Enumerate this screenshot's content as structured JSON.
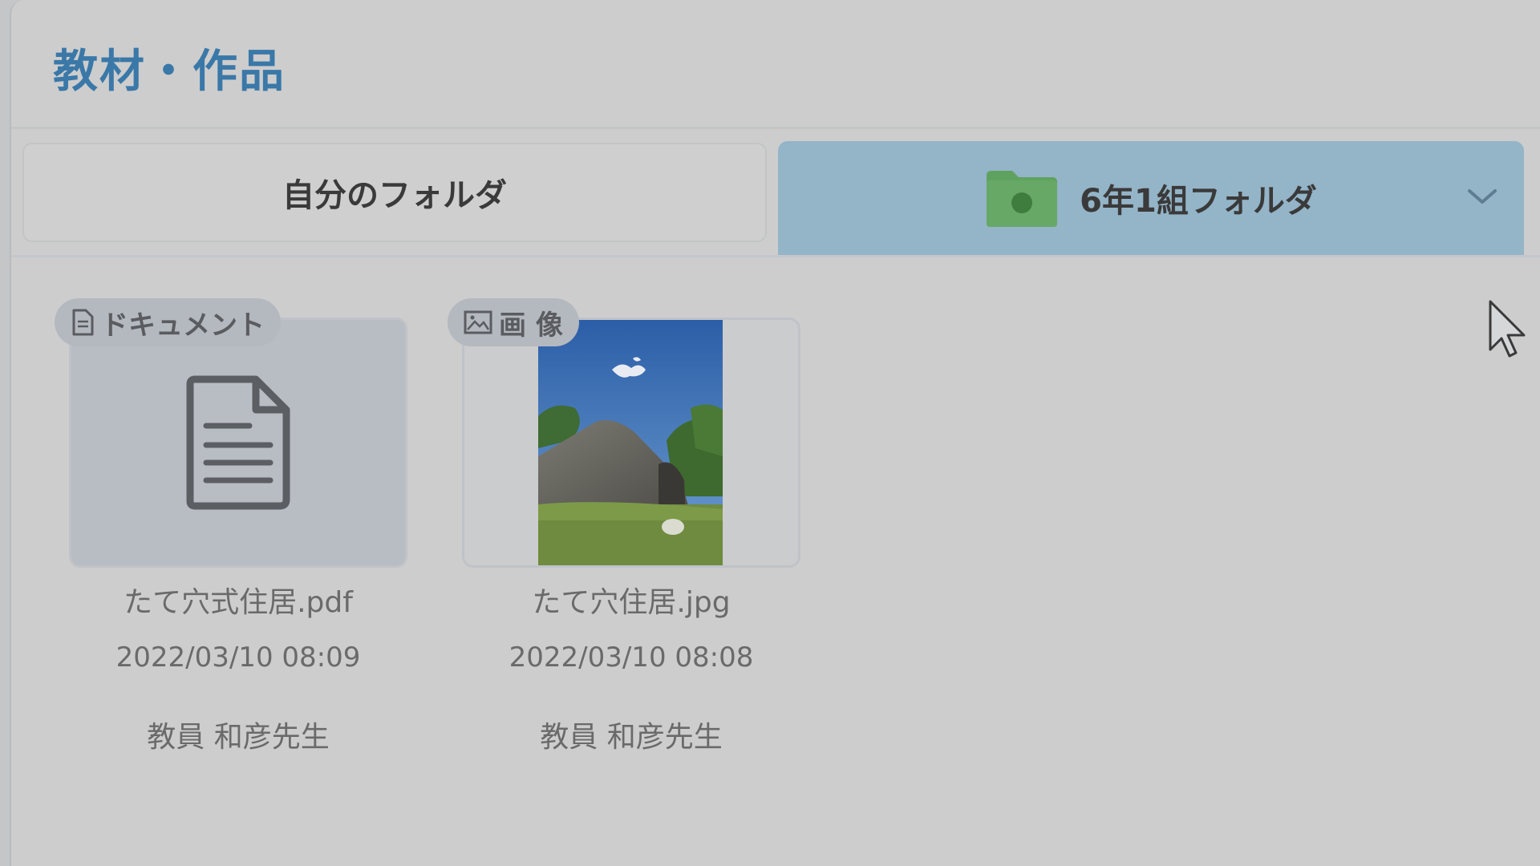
{
  "header": {
    "title": "教材・作品"
  },
  "tabs": {
    "own_folder": "自分のフォルダ",
    "class_folder": "6年1組フォルダ",
    "class_folder_icon": "folder-icon",
    "dropdown_icon": "chevron-down-icon"
  },
  "files": [
    {
      "type_label": "ドキュメント",
      "type_icon": "document-icon",
      "name": "たて穴式住居.pdf",
      "date": "2022/03/10 08:09",
      "author": "教員 和彦先生"
    },
    {
      "type_label": "画 像",
      "type_icon": "image-icon",
      "name": "たて穴住居.jpg",
      "date": "2022/03/10 08:08",
      "author": "教員 和彦先生"
    }
  ],
  "colors": {
    "title": "#3a78a8",
    "active_tab": "#94b4c8",
    "folder_green": "#5fa25f"
  }
}
